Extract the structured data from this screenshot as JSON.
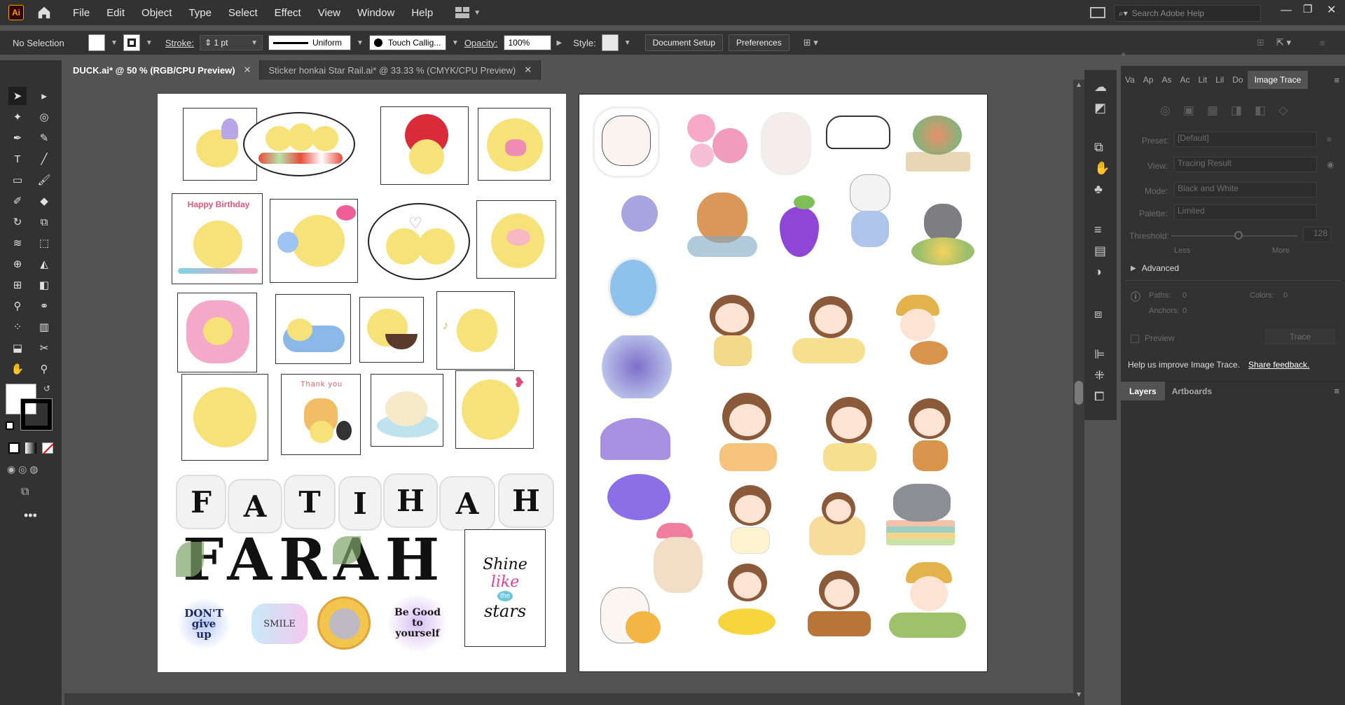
{
  "menubar": {
    "logo": "Ai",
    "items": [
      "File",
      "Edit",
      "Object",
      "Type",
      "Select",
      "Effect",
      "View",
      "Window",
      "Help"
    ],
    "search_placeholder": "Search Adobe Help"
  },
  "control": {
    "selection": "No Selection",
    "stroke_label": "Stroke:",
    "stroke_value": "1 pt",
    "profile": "Uniform",
    "brush": "Touch Callig...",
    "opacity_label": "Opacity:",
    "opacity_value": "100%",
    "style_label": "Style:",
    "document_setup": "Document Setup",
    "preferences": "Preferences"
  },
  "tabs": [
    {
      "label": "DUCK.ai* @ 50 % (RGB/CPU Preview)",
      "active": true
    },
    {
      "label": "Sticker honkai Star Rail.ai* @ 33.33 % (CMYK/CPU Preview)",
      "active": false
    }
  ],
  "artboard1": {
    "letters": [
      "F",
      "A",
      "T",
      "I",
      "H",
      "A",
      "H"
    ],
    "farah": "FARAH",
    "stickers": {
      "happy_birthday": "Happy Birthday",
      "thank_you": "Thank you",
      "dont_give_up": "DON'T give up",
      "smile": "SMILE",
      "be_good": "Be Good to yourself",
      "shine": [
        "Shine",
        "like",
        "the",
        "stars"
      ]
    }
  },
  "image_trace": {
    "tabs": [
      "Va",
      "Ap",
      "As",
      "Ac",
      "Lit",
      "Lil",
      "Do",
      "Image Trace"
    ],
    "preset_label": "Preset:",
    "preset_value": "[Default]",
    "view_label": "View:",
    "view_value": "Tracing Result",
    "mode_label": "Mode:",
    "mode_value": "Black and White",
    "palette_label": "Palette:",
    "palette_value": "Limited",
    "threshold_label": "Threshold:",
    "threshold_value": "128",
    "less": "Less",
    "more": "More",
    "advanced": "Advanced",
    "paths_label": "Paths:",
    "paths_value": "0",
    "colors_label": "Colors:",
    "colors_value": "0",
    "anchors_label": "Anchors:",
    "anchors_value": "0",
    "preview": "Preview",
    "trace": "Trace",
    "improve": "Help us improve Image Trace.",
    "feedback": "Share feedback."
  },
  "layers_panel": {
    "tabs": [
      "Layers",
      "Artboards"
    ]
  }
}
